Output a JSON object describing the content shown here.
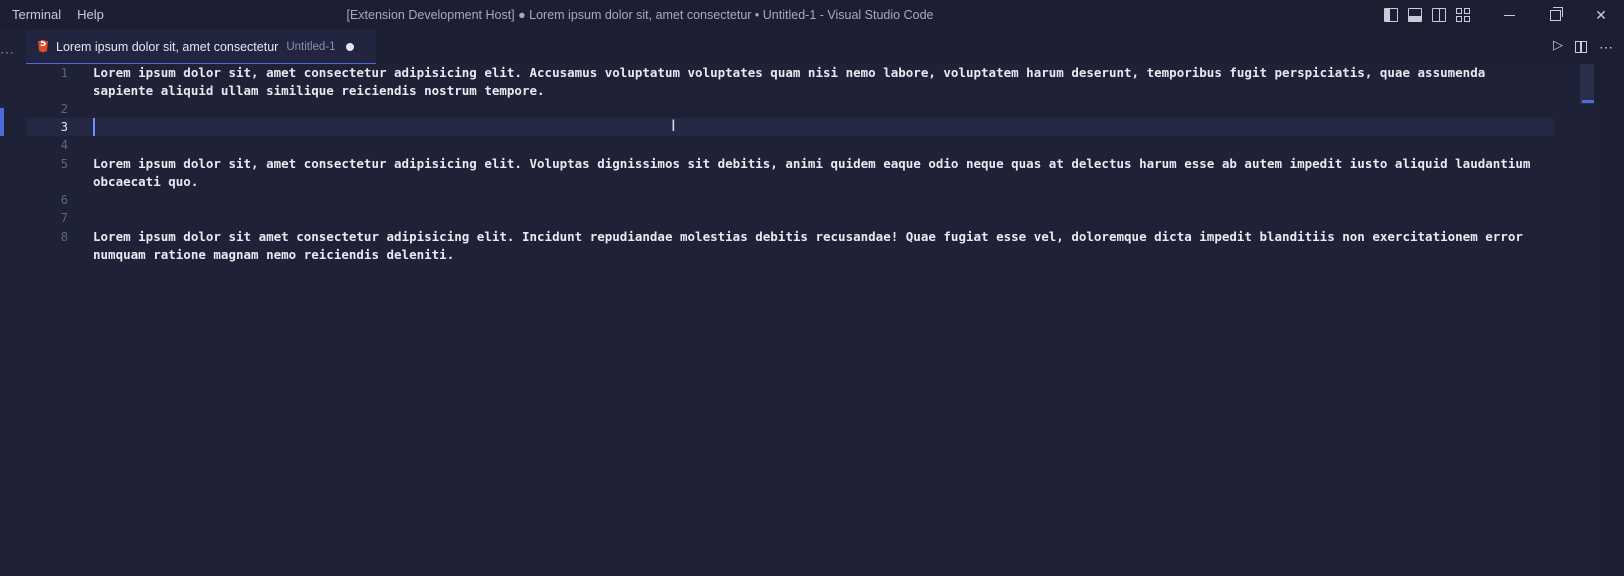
{
  "menu": {
    "items": [
      "Terminal",
      "Help"
    ]
  },
  "window": {
    "title": "[Extension Development Host] ● Lorem ipsum dolor sit, amet consectetur • Untitled-1 - Visual Studio Code"
  },
  "tab": {
    "title": "Lorem ipsum dolor sit, amet consectetur",
    "description": "Untitled-1",
    "icon": "html5-icon"
  },
  "editor": {
    "line_numbers": [
      "1",
      "2",
      "3",
      "4",
      "5",
      "6",
      "7",
      "8"
    ],
    "active_line": "3",
    "lines": [
      "Lorem ipsum dolor sit, amet consectetur adipisicing elit. Accusamus voluptatum voluptates quam nisi nemo labore, voluptatem harum deserunt, temporibus fugit perspiciatis, quae assumenda sapiente aliquid ullam similique reiciendis nostrum tempore.",
      "",
      "",
      "",
      "Lorem ipsum dolor sit, amet consectetur adipisicing elit. Voluptas dignissimos sit debitis, animi quidem eaque odio neque quas at delectus harum esse ab autem impedit iusto aliquid laudantium obcaecati quo.",
      "",
      "",
      "Lorem ipsum dolor sit amet consectetur adipisicing elit. Incidunt repudiandae molestias debitis recusandae! Quae fugiat esse vel, doloremque dicta impedit blanditiis non exercitationem error numquam ratione magnam nemo reiciendis deleniti."
    ]
  },
  "colors": {
    "accent": "#4f6bd8",
    "background": "#1f2236",
    "text": "#e9e9f1"
  },
  "icons": {
    "layout": [
      "toggle-primary-sidebar-icon",
      "toggle-panel-icon",
      "toggle-secondary-sidebar-icon",
      "customize-layout-icon"
    ],
    "window": [
      "minimize-icon",
      "restore-icon",
      "close-icon"
    ],
    "editor_actions": [
      "run-icon",
      "split-editor-icon",
      "more-actions-icon"
    ]
  }
}
